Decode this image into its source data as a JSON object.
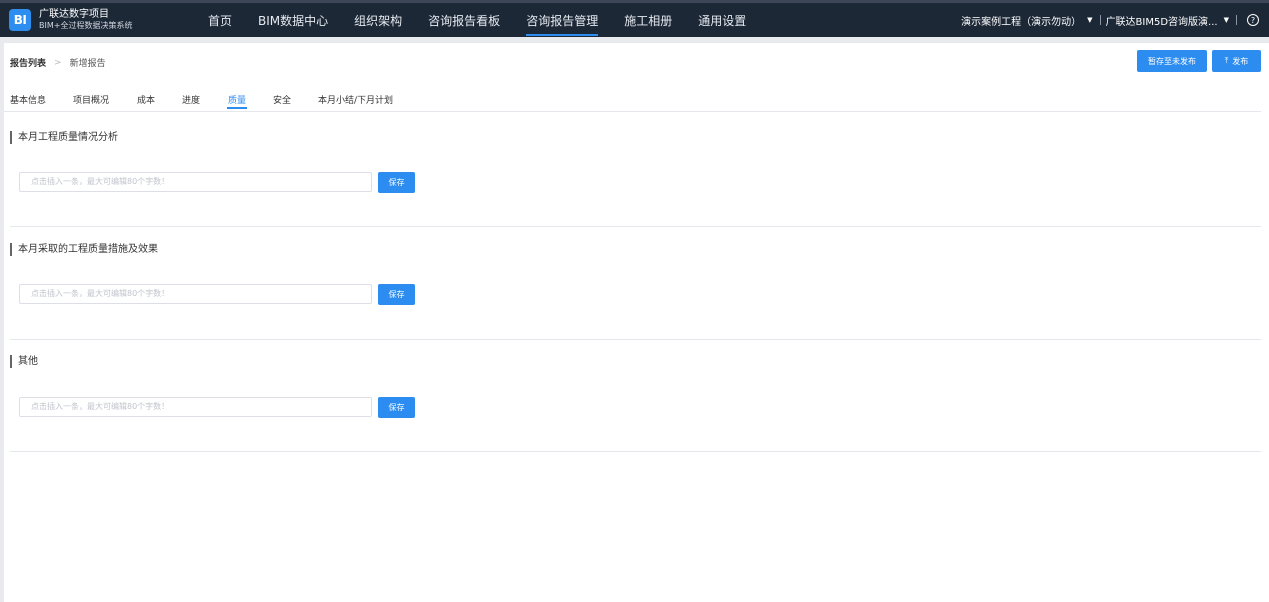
{
  "header": {
    "logo_text": "BI",
    "brand_title": "广联达数字项目",
    "brand_subtitle": "BIM+全过程数据决策系统",
    "nav": [
      {
        "label": "首页"
      },
      {
        "label": "BIM数据中心"
      },
      {
        "label": "组织架构"
      },
      {
        "label": "咨询报告看板"
      },
      {
        "label": "咨询报告管理",
        "active": true
      },
      {
        "label": "施工相册"
      },
      {
        "label": "通用设置"
      }
    ],
    "project_selector": "演示案例工程（演示勿动）",
    "org_selector": "广联达BIM5D咨询版演...",
    "help_icon": "question-circle-icon"
  },
  "breadcrumb": {
    "root": "报告列表",
    "separator": ">",
    "current": "新增报告"
  },
  "actions": {
    "save_draft": "暂存至未发布",
    "publish": "发布",
    "publish_icon": "upload-icon"
  },
  "tabs": [
    {
      "label": "基本信息"
    },
    {
      "label": "项目概况"
    },
    {
      "label": "成本"
    },
    {
      "label": "进度"
    },
    {
      "label": "质量",
      "active": true
    },
    {
      "label": "安全"
    },
    {
      "label": "本月小结/下月计划"
    }
  ],
  "sections": [
    {
      "title": "本月工程质量情况分析",
      "placeholder": "点击插入一条，最大可编辑80个字数！",
      "save_label": "保存"
    },
    {
      "title": "本月采取的工程质量措施及效果",
      "placeholder": "点击插入一条，最大可编辑80个字数！",
      "save_label": "保存"
    },
    {
      "title": "其他",
      "placeholder": "点击插入一条，最大可编辑80个字数！",
      "save_label": "保存"
    }
  ],
  "colors": {
    "accent": "#2d8cf0",
    "header_bg": "#1d2837"
  }
}
